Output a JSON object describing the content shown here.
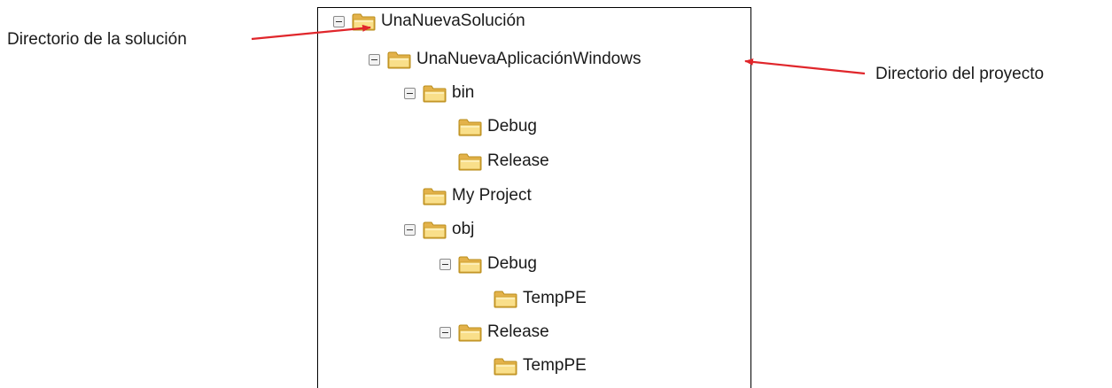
{
  "callouts": {
    "solution_dir": "Directorio de la solución",
    "project_dir": "Directorio del proyecto"
  },
  "tree": {
    "root": "UnaNuevaSolución",
    "project": "UnaNuevaAplicaciónWindows",
    "bin": "bin",
    "bin_debug": "Debug",
    "bin_release": "Release",
    "my_project": "My Project",
    "obj": "obj",
    "obj_debug": "Debug",
    "obj_debug_temppe": "TempPE",
    "obj_release": "Release",
    "obj_release_temppe": "TempPE"
  },
  "colors": {
    "arrow": "#e0262b",
    "folder_fill": "#f5d76e",
    "folder_edge": "#b98c1a"
  },
  "icons": {
    "expander": "minus-box-icon",
    "folder": "folder-icon"
  }
}
